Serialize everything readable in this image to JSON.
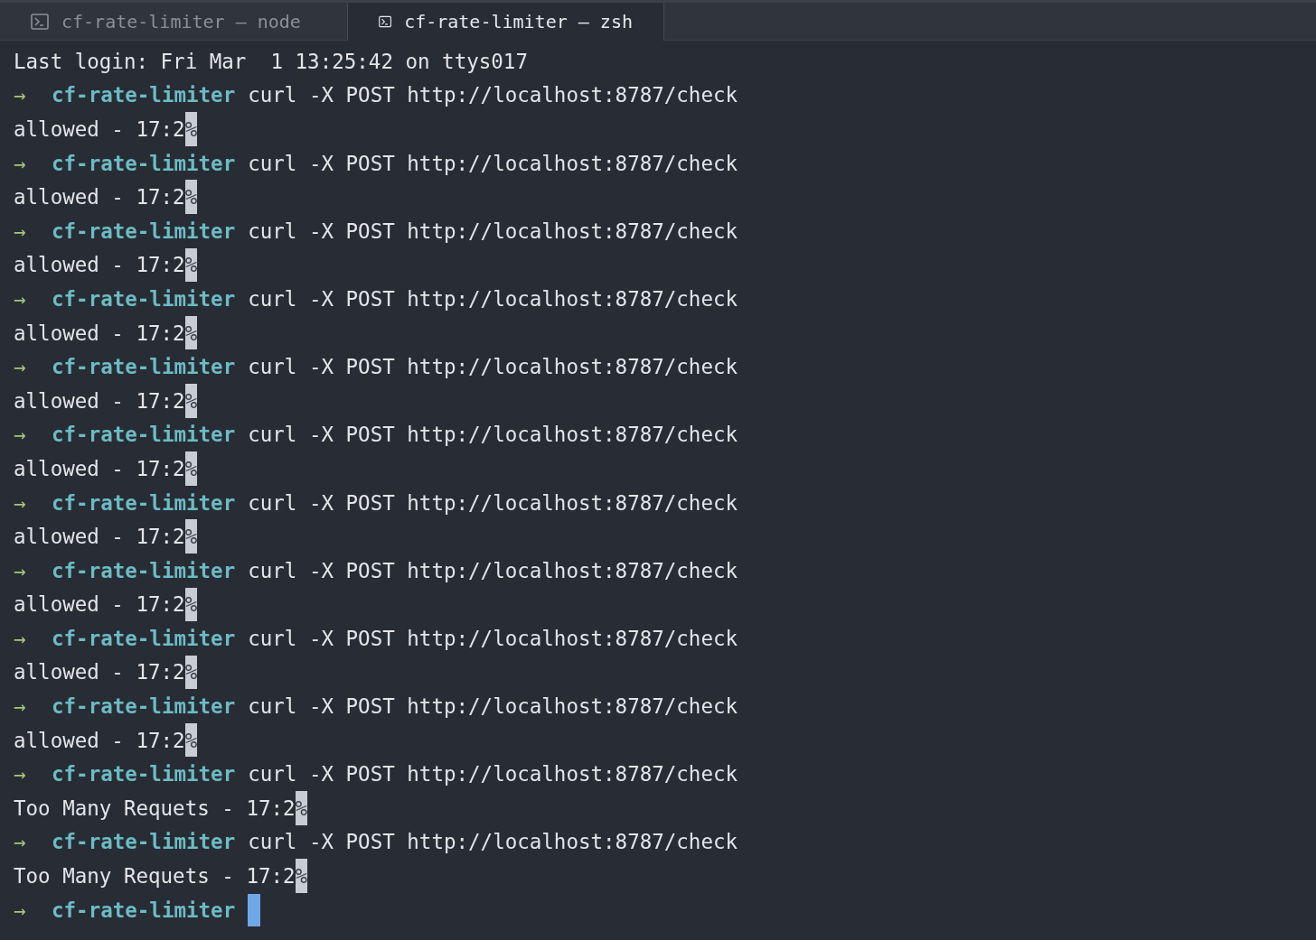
{
  "tabs": [
    {
      "label": "cf-rate-limiter — node",
      "selected": false
    },
    {
      "label": "cf-rate-limiter — zsh",
      "selected": true
    }
  ],
  "terminal": {
    "lines": [
      {
        "kind": "output",
        "text": "Last login: Fri Mar  1 13:25:42 on ttys017"
      },
      {
        "kind": "prompt",
        "arrow": "→",
        "directory": "cf-rate-limiter",
        "command": "curl -X POST http://localhost:8787/check"
      },
      {
        "kind": "output",
        "text": "allowed - 17:2",
        "end_mark": "%"
      },
      {
        "kind": "prompt",
        "arrow": "→",
        "directory": "cf-rate-limiter",
        "command": "curl -X POST http://localhost:8787/check"
      },
      {
        "kind": "output",
        "text": "allowed - 17:2",
        "end_mark": "%"
      },
      {
        "kind": "prompt",
        "arrow": "→",
        "directory": "cf-rate-limiter",
        "command": "curl -X POST http://localhost:8787/check"
      },
      {
        "kind": "output",
        "text": "allowed - 17:2",
        "end_mark": "%"
      },
      {
        "kind": "prompt",
        "arrow": "→",
        "directory": "cf-rate-limiter",
        "command": "curl -X POST http://localhost:8787/check"
      },
      {
        "kind": "output",
        "text": "allowed - 17:2",
        "end_mark": "%"
      },
      {
        "kind": "prompt",
        "arrow": "→",
        "directory": "cf-rate-limiter",
        "command": "curl -X POST http://localhost:8787/check"
      },
      {
        "kind": "output",
        "text": "allowed - 17:2",
        "end_mark": "%"
      },
      {
        "kind": "prompt",
        "arrow": "→",
        "directory": "cf-rate-limiter",
        "command": "curl -X POST http://localhost:8787/check"
      },
      {
        "kind": "output",
        "text": "allowed - 17:2",
        "end_mark": "%"
      },
      {
        "kind": "prompt",
        "arrow": "→",
        "directory": "cf-rate-limiter",
        "command": "curl -X POST http://localhost:8787/check"
      },
      {
        "kind": "output",
        "text": "allowed - 17:2",
        "end_mark": "%"
      },
      {
        "kind": "prompt",
        "arrow": "→",
        "directory": "cf-rate-limiter",
        "command": "curl -X POST http://localhost:8787/check"
      },
      {
        "kind": "output",
        "text": "allowed - 17:2",
        "end_mark": "%"
      },
      {
        "kind": "prompt",
        "arrow": "→",
        "directory": "cf-rate-limiter",
        "command": "curl -X POST http://localhost:8787/check"
      },
      {
        "kind": "output",
        "text": "allowed - 17:2",
        "end_mark": "%"
      },
      {
        "kind": "prompt",
        "arrow": "→",
        "directory": "cf-rate-limiter",
        "command": "curl -X POST http://localhost:8787/check"
      },
      {
        "kind": "output",
        "text": "allowed - 17:2",
        "end_mark": "%"
      },
      {
        "kind": "prompt",
        "arrow": "→",
        "directory": "cf-rate-limiter",
        "command": "curl -X POST http://localhost:8787/check"
      },
      {
        "kind": "output",
        "text": "Too Many Requets - 17:2",
        "end_mark": "%"
      },
      {
        "kind": "prompt",
        "arrow": "→",
        "directory": "cf-rate-limiter",
        "command": "curl -X POST http://localhost:8787/check"
      },
      {
        "kind": "output",
        "text": "Too Many Requets - 17:2",
        "end_mark": "%"
      },
      {
        "kind": "prompt",
        "arrow": "→",
        "directory": "cf-rate-limiter",
        "cursor": true
      }
    ]
  }
}
